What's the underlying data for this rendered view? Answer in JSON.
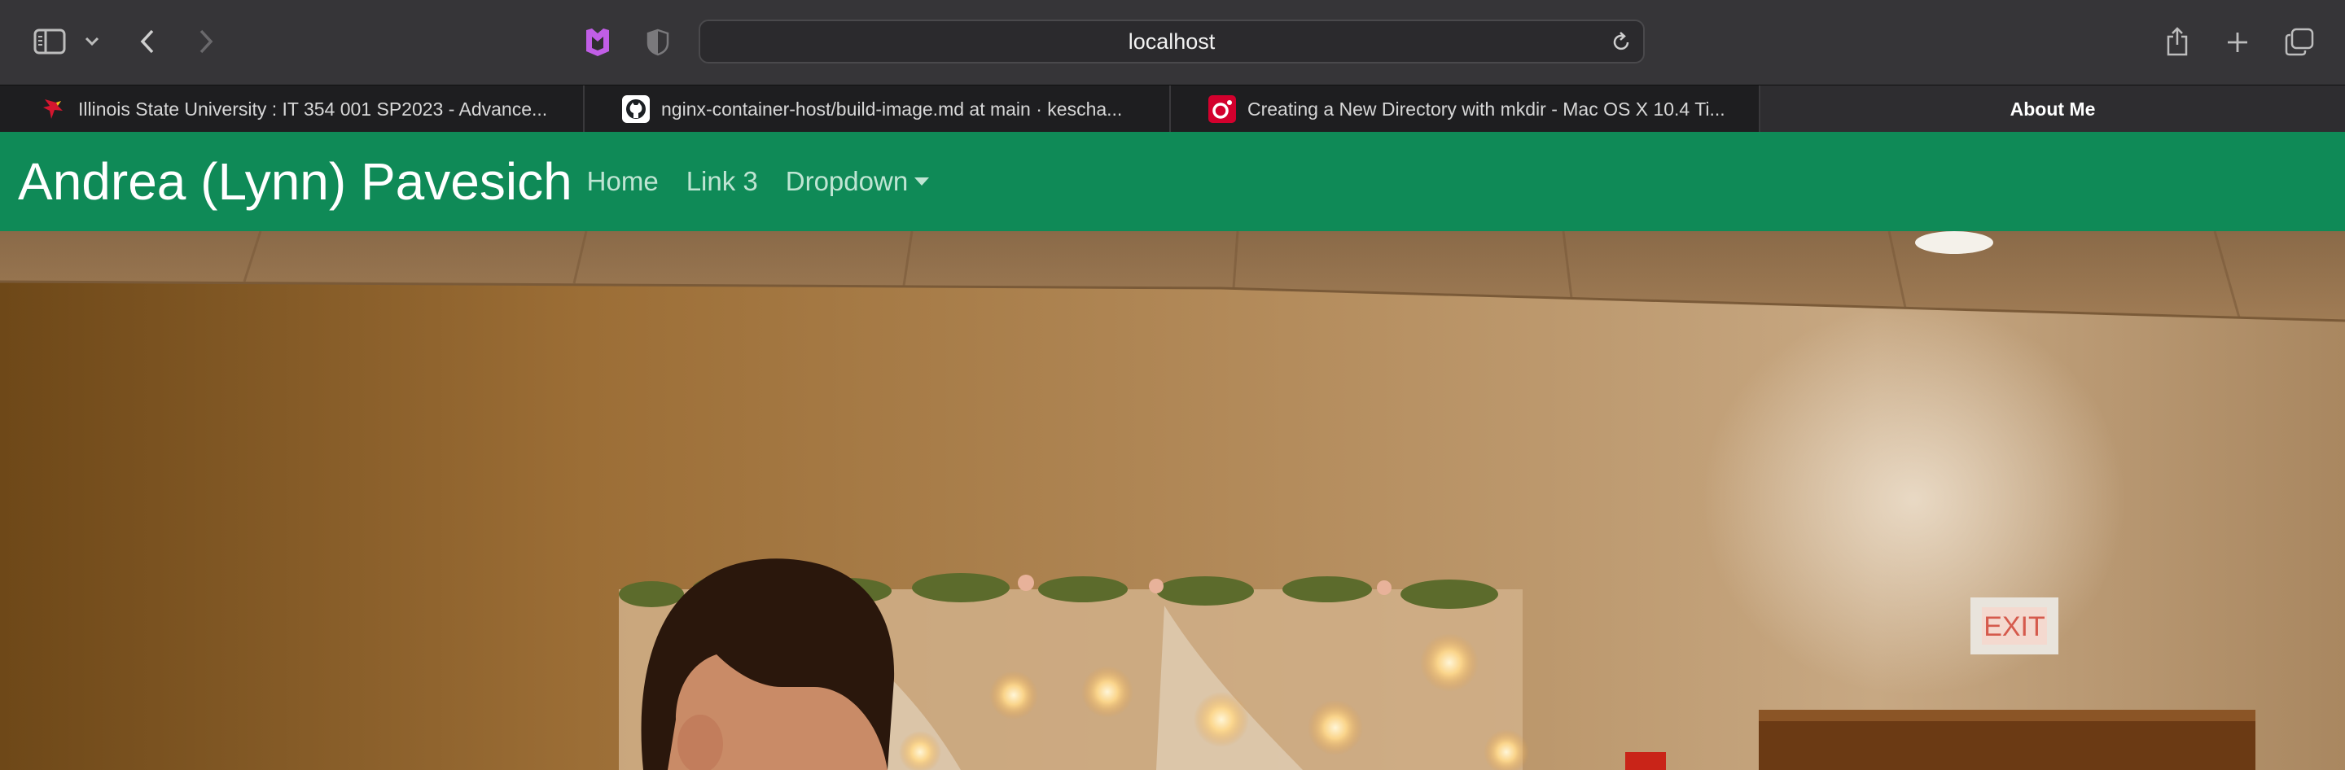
{
  "browser": {
    "address_text": "localhost",
    "tabs": [
      {
        "title": "Illinois State University : IT 354 001 SP2023 - Advance...",
        "icon": "redbird-favicon-icon",
        "active": false
      },
      {
        "title": "nginx-container-host/build-image.md at main · kescha...",
        "icon": "github-favicon-icon",
        "active": false
      },
      {
        "title": "Creating a New Directory with mkdir - Mac OS X 10.4 Ti...",
        "icon": "oreilly-favicon-icon",
        "active": false
      },
      {
        "title": "About Me",
        "icon": "",
        "active": true
      }
    ]
  },
  "site": {
    "brand": "Andrea (Lynn) Pavesich",
    "nav": {
      "home": "Home",
      "link3": "Link 3",
      "dropdown": "Dropdown"
    },
    "navbar_color": "#0f8a57"
  },
  "hero": {
    "exit_sign": "EXIT"
  }
}
